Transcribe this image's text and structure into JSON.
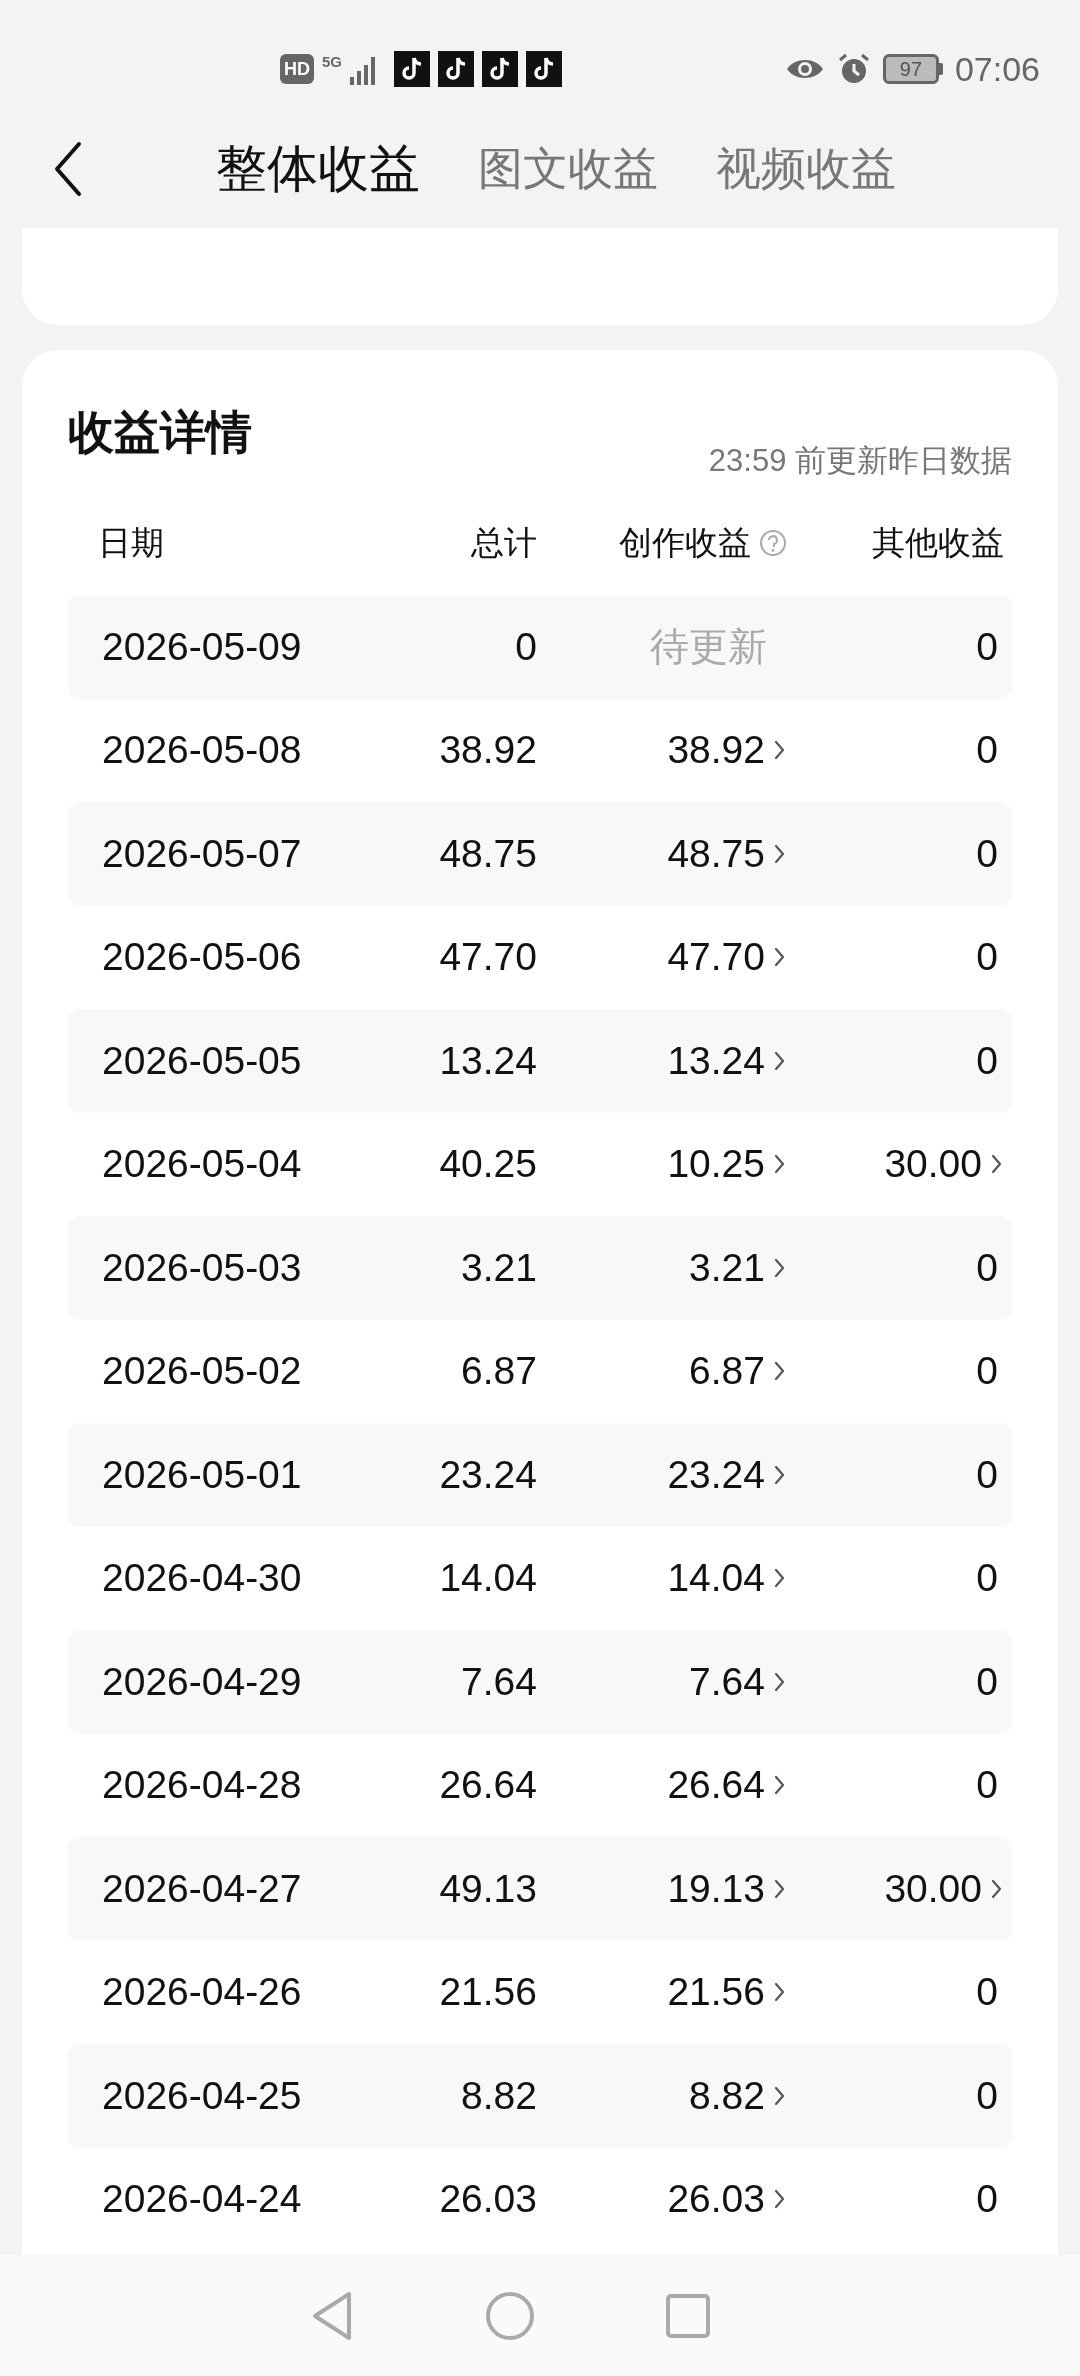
{
  "status_bar": {
    "hd": "HD",
    "network": "5G",
    "notifications": [
      {
        "kind": "music-app"
      },
      {
        "kind": "music-app"
      },
      {
        "kind": "music-app"
      },
      {
        "kind": "music-app"
      }
    ],
    "battery": "97",
    "time": "07:06"
  },
  "tabs": [
    {
      "label": "整体收益",
      "selected": true
    },
    {
      "label": "图文收益",
      "selected": false
    },
    {
      "label": "视频收益",
      "selected": false
    }
  ],
  "details": {
    "title": "收益详情",
    "note": "23:59 前更新昨日数据",
    "columns": [
      "日期",
      "总计",
      "创作收益",
      "其他收益"
    ],
    "rows": [
      {
        "date": "2026-05-09",
        "total": "0",
        "creation": "待更新",
        "creation_pending": true,
        "creation_link": false,
        "other": "0",
        "other_link": false
      },
      {
        "date": "2026-05-08",
        "total": "38.92",
        "creation": "38.92",
        "creation_pending": false,
        "creation_link": true,
        "other": "0",
        "other_link": false
      },
      {
        "date": "2026-05-07",
        "total": "48.75",
        "creation": "48.75",
        "creation_pending": false,
        "creation_link": true,
        "other": "0",
        "other_link": false
      },
      {
        "date": "2026-05-06",
        "total": "47.70",
        "creation": "47.70",
        "creation_pending": false,
        "creation_link": true,
        "other": "0",
        "other_link": false
      },
      {
        "date": "2026-05-05",
        "total": "13.24",
        "creation": "13.24",
        "creation_pending": false,
        "creation_link": true,
        "other": "0",
        "other_link": false
      },
      {
        "date": "2026-05-04",
        "total": "40.25",
        "creation": "10.25",
        "creation_pending": false,
        "creation_link": true,
        "other": "30.00",
        "other_link": true
      },
      {
        "date": "2026-05-03",
        "total": "3.21",
        "creation": "3.21",
        "creation_pending": false,
        "creation_link": true,
        "other": "0",
        "other_link": false
      },
      {
        "date": "2026-05-02",
        "total": "6.87",
        "creation": "6.87",
        "creation_pending": false,
        "creation_link": true,
        "other": "0",
        "other_link": false
      },
      {
        "date": "2026-05-01",
        "total": "23.24",
        "creation": "23.24",
        "creation_pending": false,
        "creation_link": true,
        "other": "0",
        "other_link": false
      },
      {
        "date": "2026-04-30",
        "total": "14.04",
        "creation": "14.04",
        "creation_pending": false,
        "creation_link": true,
        "other": "0",
        "other_link": false
      },
      {
        "date": "2026-04-29",
        "total": "7.64",
        "creation": "7.64",
        "creation_pending": false,
        "creation_link": true,
        "other": "0",
        "other_link": false
      },
      {
        "date": "2026-04-28",
        "total": "26.64",
        "creation": "26.64",
        "creation_pending": false,
        "creation_link": true,
        "other": "0",
        "other_link": false
      },
      {
        "date": "2026-04-27",
        "total": "49.13",
        "creation": "19.13",
        "creation_pending": false,
        "creation_link": true,
        "other": "30.00",
        "other_link": true
      },
      {
        "date": "2026-04-26",
        "total": "21.56",
        "creation": "21.56",
        "creation_pending": false,
        "creation_link": true,
        "other": "0",
        "other_link": false
      },
      {
        "date": "2026-04-25",
        "total": "8.82",
        "creation": "8.82",
        "creation_pending": false,
        "creation_link": true,
        "other": "0",
        "other_link": false
      },
      {
        "date": "2026-04-24",
        "total": "26.03",
        "creation": "26.03",
        "creation_pending": false,
        "creation_link": true,
        "other": "0",
        "other_link": false
      }
    ]
  }
}
